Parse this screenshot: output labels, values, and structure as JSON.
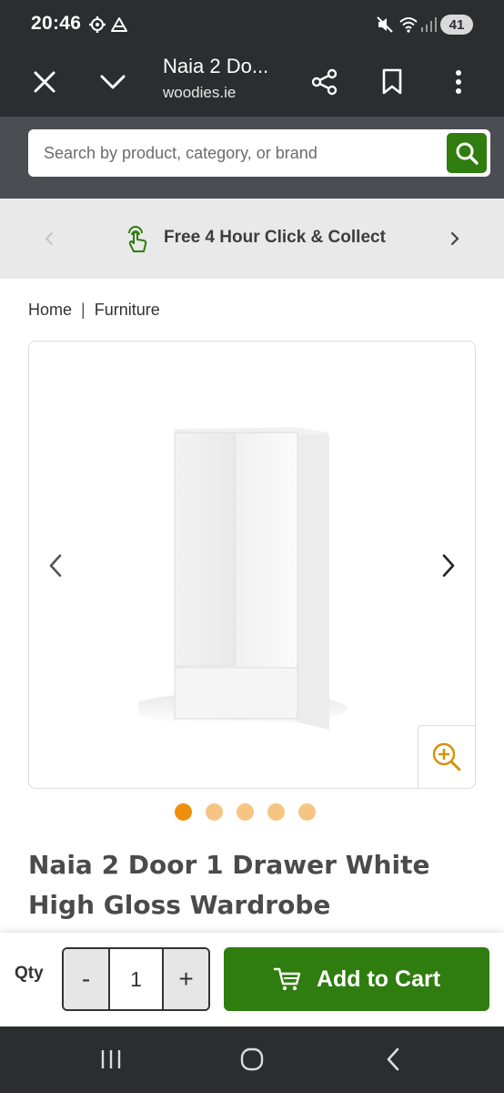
{
  "status_bar": {
    "time": "20:46",
    "icons": [
      "gear-icon",
      "drive-icon",
      "mute-icon",
      "wifi-icon",
      "signal-icon"
    ],
    "battery": "41"
  },
  "browser": {
    "page_title": "Naia 2 Do...",
    "url": "woodies.ie",
    "icons": [
      "close-icon",
      "chevron-down-icon",
      "share-icon",
      "bookmark-icon",
      "more-icon"
    ]
  },
  "search": {
    "placeholder": "Search by product, category, or brand",
    "icon": "search-icon",
    "accent_color": "#2e7d0e"
  },
  "promo": {
    "text": "Free 4 Hour Click & Collect",
    "icon": "tap-hand-icon"
  },
  "breadcrumb": {
    "items": [
      "Home",
      "Furniture"
    ],
    "separator": "|"
  },
  "gallery": {
    "image": "white-wardrobe-image",
    "dot_count": 5,
    "active_dot": 1,
    "dot_color": "#f6c584",
    "active_dot_color": "#ee8f0c"
  },
  "product": {
    "title": "Naia 2 Door 1 Drawer White High Gloss Wardrobe"
  },
  "cart": {
    "qty_label": "Qty",
    "minus": "-",
    "quantity": "1",
    "plus": "+",
    "add_label": "Add to Cart",
    "button_color": "#2e7d0e"
  },
  "system_nav": [
    "recents-icon",
    "home-icon",
    "back-icon"
  ]
}
